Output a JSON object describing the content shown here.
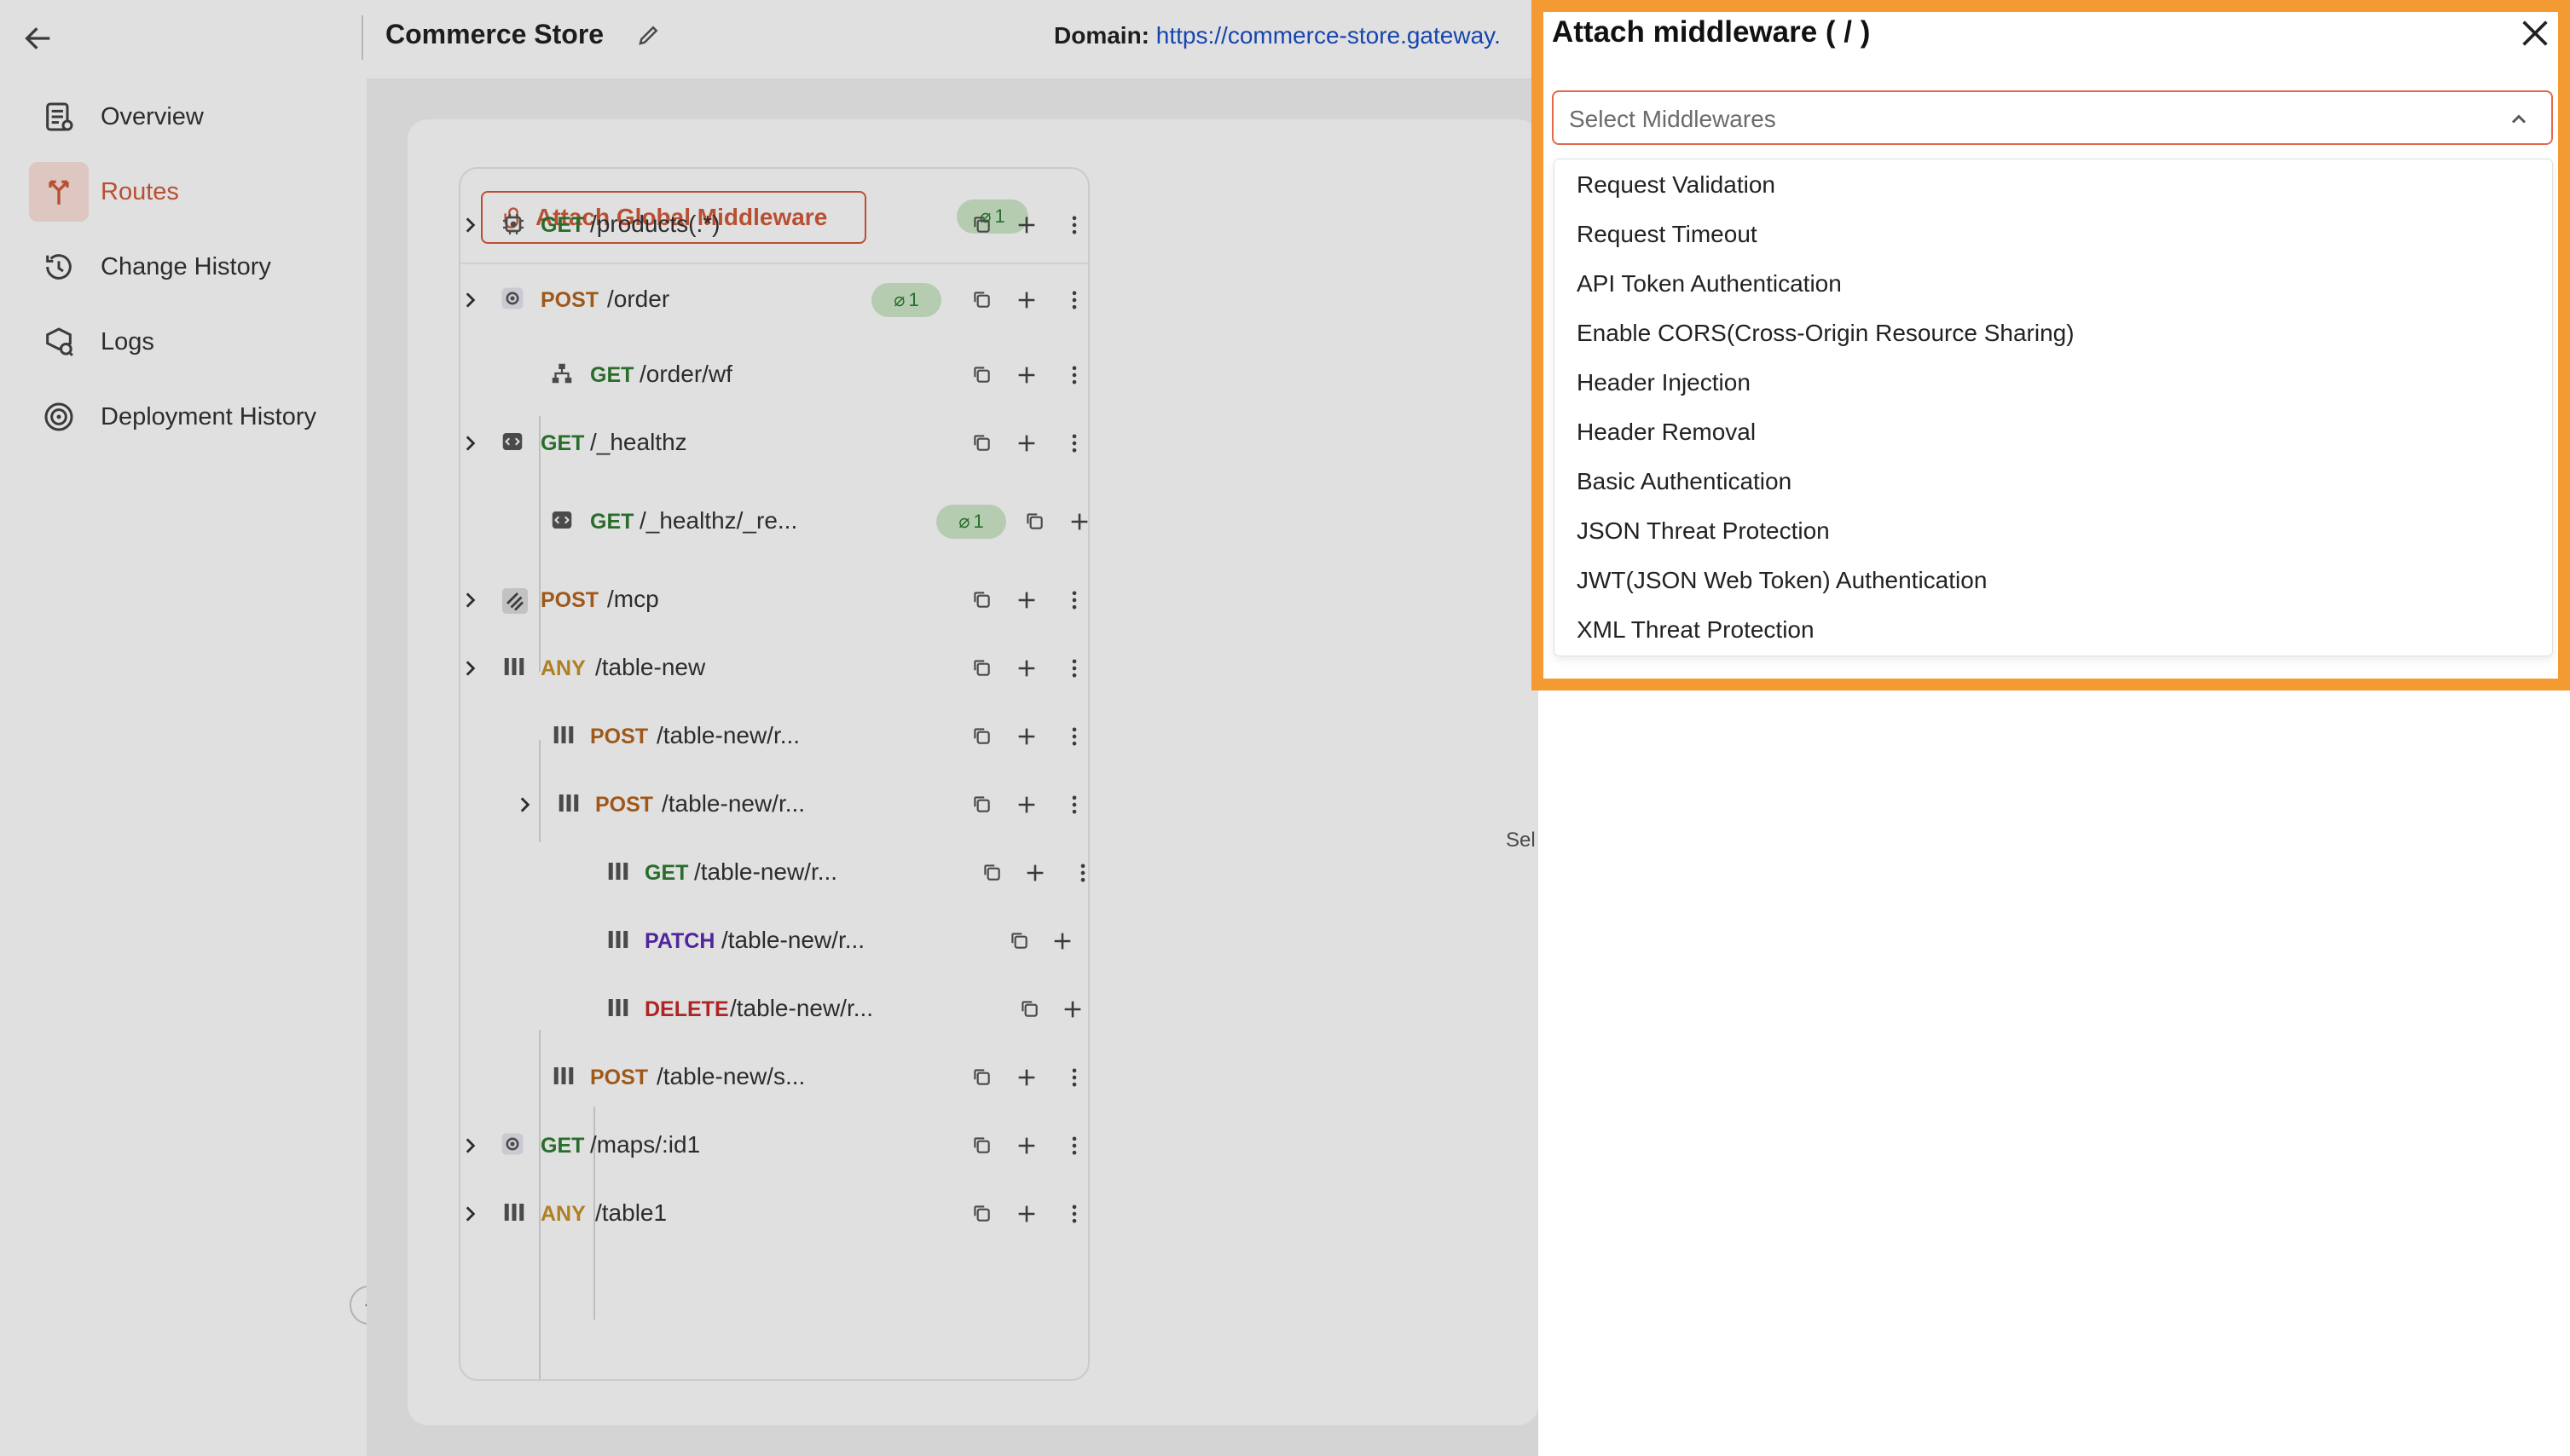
{
  "header": {
    "title": "Commerce Store",
    "domain_label": "Domain:",
    "domain_url": "https://commerce-store.gateway."
  },
  "sidebar": {
    "items": [
      {
        "label": "Overview",
        "icon": "overview-icon",
        "active": false
      },
      {
        "label": "Routes",
        "icon": "routes-icon",
        "active": true
      },
      {
        "label": "Change History",
        "icon": "history-icon",
        "active": false
      },
      {
        "label": "Logs",
        "icon": "logs-icon",
        "active": false
      },
      {
        "label": "Deployment History",
        "icon": "deployment-icon",
        "active": false
      }
    ]
  },
  "routes_panel": {
    "global_middleware_label": "Attach Global Middleware",
    "global_middleware_count": "1",
    "routes": [
      {
        "method": "GET",
        "path": "/"
      },
      {
        "method": "GET",
        "path": "/products(.*)"
      },
      {
        "method": "POST",
        "path": "/order",
        "badge": "1"
      },
      {
        "method": "GET",
        "path": "/order/wf"
      },
      {
        "method": "GET",
        "path": "/_healthz"
      },
      {
        "method": "GET",
        "path": "/_healthz/_re...",
        "badge": "1"
      },
      {
        "method": "POST",
        "path": "/mcp"
      },
      {
        "method": "ANY",
        "path": "/table-new"
      },
      {
        "method": "POST",
        "path": "/table-new/r..."
      },
      {
        "method": "POST",
        "path": "/table-new/r..."
      },
      {
        "method": "GET",
        "path": "/table-new/r..."
      },
      {
        "method": "PATCH",
        "path": "/table-new/r..."
      },
      {
        "method": "DELETE",
        "path": "/table-new/r..."
      },
      {
        "method": "POST",
        "path": "/table-new/s..."
      },
      {
        "method": "GET",
        "path": "/maps/:id1"
      },
      {
        "method": "ANY",
        "path": "/table1"
      }
    ],
    "partial_text": "Sel"
  },
  "drawer": {
    "title": "Attach middleware ( / )",
    "select_placeholder": "Select Middlewares",
    "options": [
      "Request Validation",
      "Request Timeout",
      "API Token Authentication",
      "Enable CORS(Cross-Origin Resource Sharing)",
      "Header Injection",
      "Header Removal",
      "Basic Authentication",
      "JSON Threat Protection",
      "JWT(JSON Web Token) Authentication",
      "XML Threat Protection"
    ]
  },
  "colors": {
    "accent": "#d35a3a",
    "highlight_border": "#f39a32",
    "get": "#2e7d32",
    "post": "#b5651d",
    "patch": "#5b2bb0",
    "delete": "#c62828",
    "link": "#1a4fc7"
  }
}
